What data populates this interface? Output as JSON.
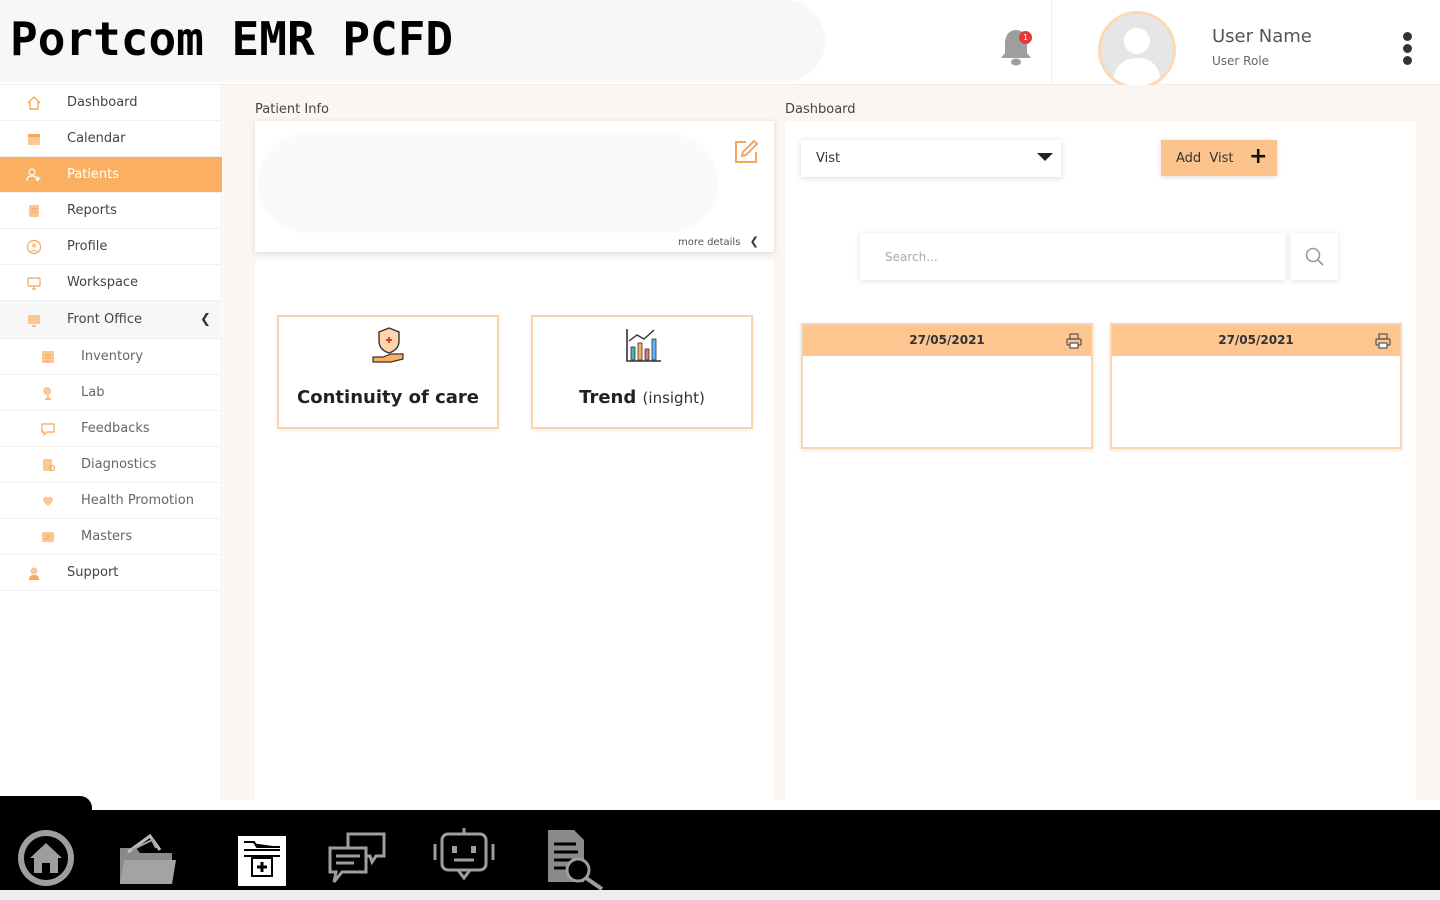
{
  "header": {
    "app_title": "Portcom EMR PCFD",
    "notification_count": "1",
    "user_name": "User Name",
    "user_role": "User Role"
  },
  "sidebar": {
    "items": [
      {
        "label": "Dashboard",
        "icon": "home-icon"
      },
      {
        "label": "Calendar",
        "icon": "calendar-icon"
      },
      {
        "label": "Patients",
        "icon": "patients-icon",
        "active": true
      },
      {
        "label": "Reports",
        "icon": "reports-icon"
      },
      {
        "label": "Profile",
        "icon": "profile-icon"
      },
      {
        "label": "Workspace",
        "icon": "workspace-icon"
      },
      {
        "label": "Front Office",
        "icon": "front-office-icon",
        "expanded": true
      },
      {
        "label": "Inventory",
        "icon": "inventory-icon",
        "sub": true
      },
      {
        "label": "Lab",
        "icon": "lab-icon",
        "sub": true
      },
      {
        "label": "Feedbacks",
        "icon": "feedback-icon",
        "sub": true
      },
      {
        "label": "Diagnostics",
        "icon": "diagnostics-icon",
        "sub": true
      },
      {
        "label": "Health Promotion",
        "icon": "health-promotion-icon",
        "sub": true
      },
      {
        "label": "Masters",
        "icon": "masters-icon",
        "sub": true
      },
      {
        "label": "Support",
        "icon": "support-icon"
      }
    ]
  },
  "patient_info": {
    "section_label": "Patient Info",
    "more_details": "more details"
  },
  "tiles": {
    "continuity": "Continuity of care",
    "trend_main": "Trend",
    "trend_sub": "(insight)"
  },
  "dashboard": {
    "section_label": "Dashboard",
    "visit_select_value": "Vist",
    "add_visit_label": "Add  Vist",
    "search_placeholder": "Search...",
    "visit_cards": [
      {
        "date": "27/05/2021"
      },
      {
        "date": "27/05/2021"
      }
    ]
  },
  "colors": {
    "accent": "#fbb061",
    "accent_light": "#fdc590",
    "dock": "#000000"
  },
  "dock": {
    "icons": [
      "home-icon",
      "folder-icon",
      "medical-record-icon",
      "chat-icon",
      "bot-icon",
      "document-search-icon"
    ]
  }
}
